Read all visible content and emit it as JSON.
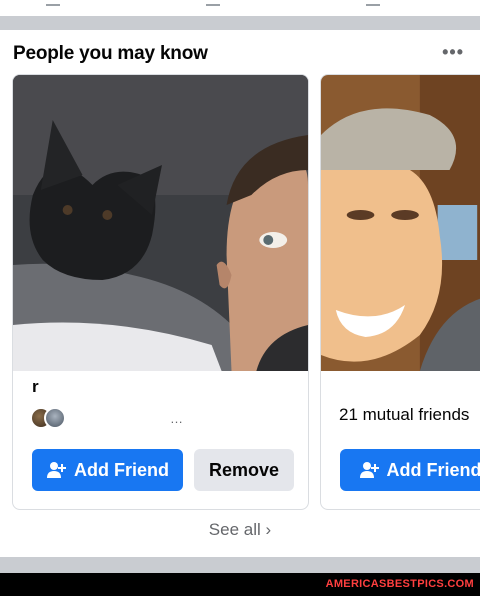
{
  "section": {
    "title": "People you may know",
    "more_label": "•••"
  },
  "suggestions": [
    {
      "name": "r",
      "mutual": "…",
      "add_label": "Add Friend",
      "remove_label": "Remove"
    },
    {
      "name": "",
      "mutual": "21 mutual friends",
      "add_label": "Add Friend"
    }
  ],
  "see_all": {
    "label": "See all",
    "chevron": "›"
  },
  "watermark": "AMERICASBESTPICS.COM",
  "colors": {
    "accent": "#1877f2",
    "watermark": "#ff3f3f"
  }
}
